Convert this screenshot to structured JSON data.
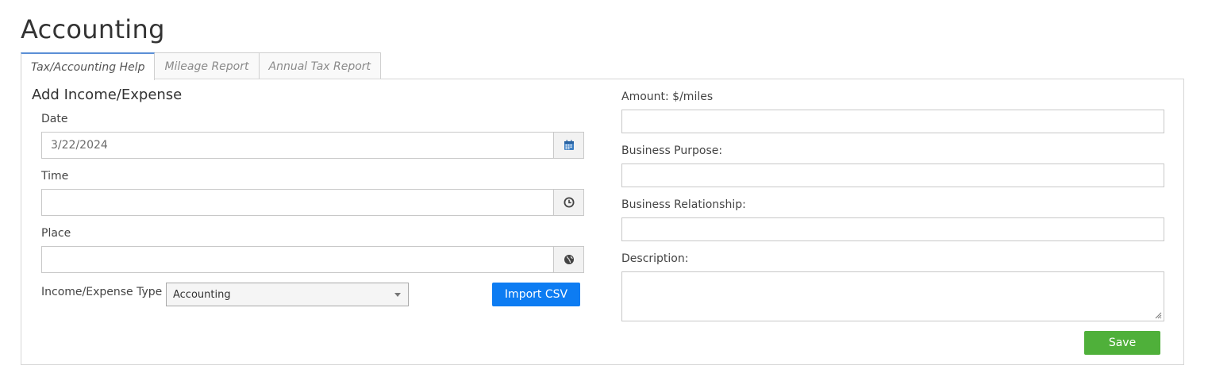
{
  "page": {
    "title": "Accounting"
  },
  "tabs": [
    {
      "label": "Tax/Accounting Help",
      "active": true
    },
    {
      "label": "Mileage Report",
      "active": false
    },
    {
      "label": "Annual Tax Report",
      "active": false
    }
  ],
  "form": {
    "section_title": "Add Income/Expense",
    "date": {
      "label": "Date",
      "value": "3/22/2024",
      "icon": "calendar-icon"
    },
    "time": {
      "label": "Time",
      "value": "",
      "icon": "clock-icon"
    },
    "place": {
      "label": "Place",
      "value": "",
      "icon": "globe-icon"
    },
    "type": {
      "label": "Income/Expense Type",
      "selected": "Accounting"
    },
    "import_label": "Import CSV",
    "amount": {
      "label": "Amount: $/miles",
      "value": ""
    },
    "business_purpose": {
      "label": "Business Purpose:",
      "value": ""
    },
    "business_relationship": {
      "label": "Business Relationship:",
      "value": ""
    },
    "description": {
      "label": "Description:",
      "value": ""
    },
    "save_label": "Save"
  },
  "colors": {
    "import_button": "#0d7cf2",
    "save_button": "#4fb03a",
    "active_tab_border": "#5b8fd6"
  }
}
